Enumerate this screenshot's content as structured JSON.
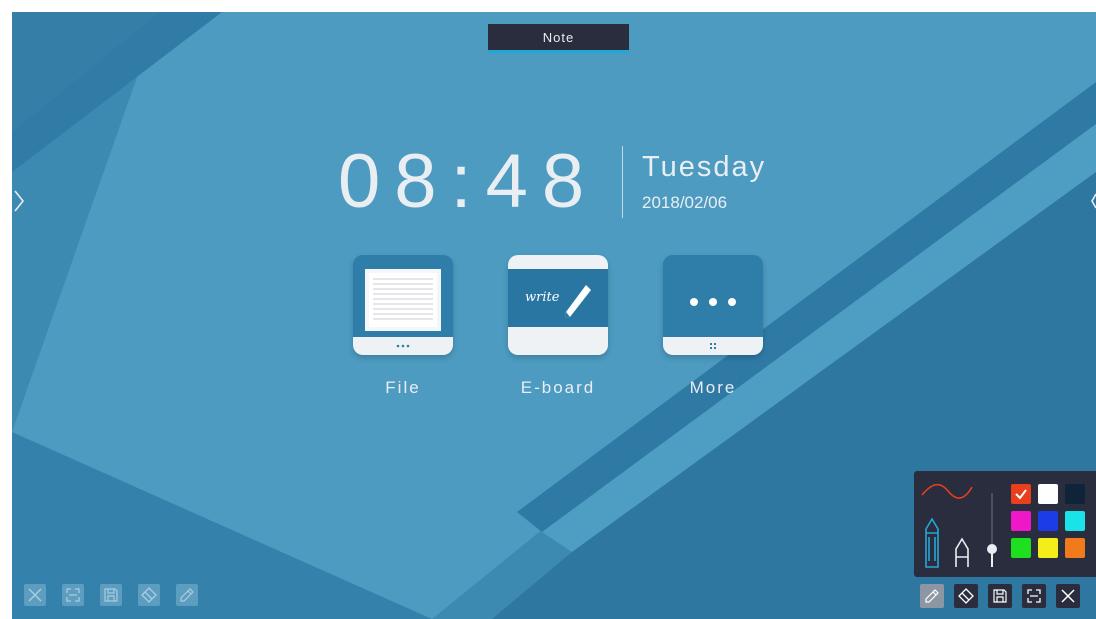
{
  "header": {
    "tab_label": "Note"
  },
  "clock": {
    "time": "08:48",
    "weekday": "Tuesday",
    "date": "2018/02/06"
  },
  "apps": [
    {
      "label": "File",
      "icon": "file-icon"
    },
    {
      "label": "E-board",
      "icon": "eboard-icon",
      "icon_text": "write"
    },
    {
      "label": "More",
      "icon": "more-icon"
    }
  ],
  "left_toolbar": [
    "close-icon",
    "screenshot-icon",
    "save-icon",
    "eraser-icon",
    "pen-icon"
  ],
  "right_toolbar": [
    "pen-icon",
    "eraser-icon",
    "save-icon",
    "screenshot-icon",
    "close-icon"
  ],
  "pen_panel": {
    "selected_color": "#e8401c",
    "colors": [
      "#e8401c",
      "#ffffff",
      "#0f2438",
      "#ef18c8",
      "#1c3ce8",
      "#19e2e8",
      "#1fe01f",
      "#f3ee1a",
      "#f07a1c"
    ]
  },
  "colors": {
    "accent": "#25a7d6",
    "background": "#3b86ad",
    "panel": "#2a2d3d"
  }
}
